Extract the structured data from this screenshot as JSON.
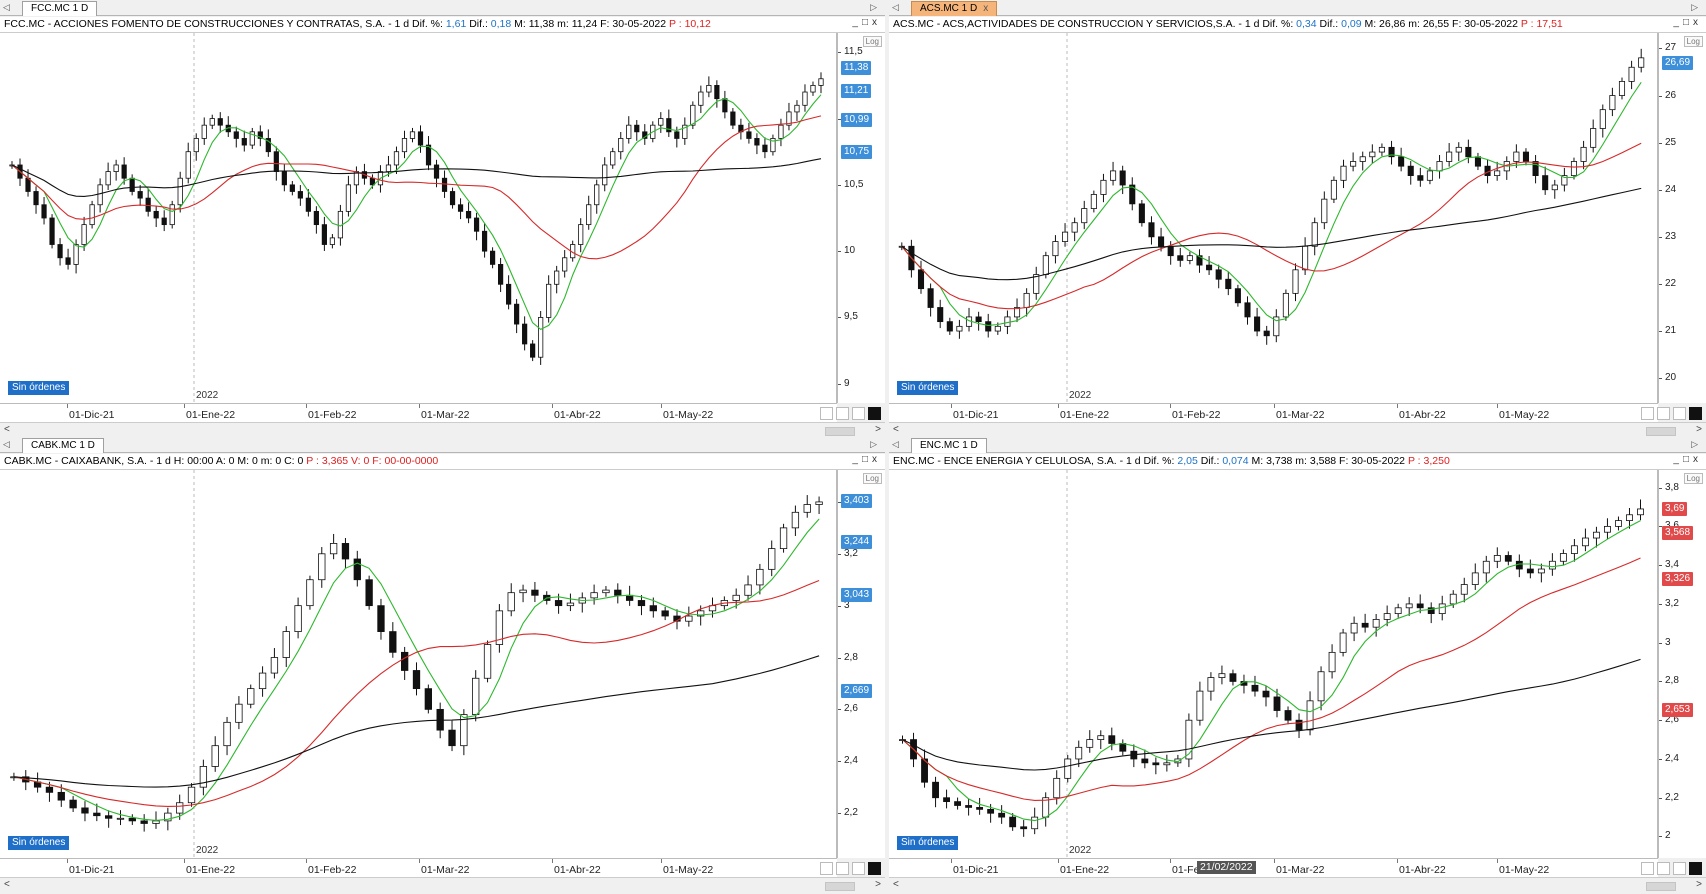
{
  "ui": {
    "sin_ordenes": "Sin órdenes",
    "log_label": "Log",
    "year_label": "2022",
    "close_glyph": "x",
    "win_min": "_",
    "win_max": "□",
    "win_close": "x",
    "scroll_left": "<",
    "scroll_right": ">",
    "tab_left_arrow": "◁",
    "tab_right_arrow": "▷"
  },
  "colors": {
    "ma_short": "#2db82d",
    "ma_mid": "#d62a2a",
    "ma_long": "#111111",
    "candle": "#111111",
    "tag_blue": "#3d8fd9",
    "tag_red": "#e04a4a",
    "active_tab": "#f5b57a"
  },
  "icons": [
    "crosshair-icon",
    "save-icon",
    "pin-icon",
    "color-box-icon"
  ],
  "panels": [
    {
      "id": "fcc",
      "tab": "FCC.MC 1 D",
      "active": false,
      "title": {
        "prefix": "FCC.MC - ACCIONES FOMENTO DE CONSTRUCCIONES Y CONTRATAS, S.A. -  1 d  Dif. %: ",
        "dif_pct": "1,61",
        "mid": "  Dif.: ",
        "dif": "0,18",
        "rest": "  M: 11,38  m: 11,24  F: 30-05-2022  ",
        "p": "P : 10,12"
      },
      "yticks": [
        "11,5",
        "11",
        "10,5",
        "10",
        "9,5",
        "9"
      ],
      "ymin": 8.9,
      "ymax": 11.6,
      "tags": [
        {
          "v": "11,38",
          "c": "blue"
        },
        {
          "v": "11,21",
          "c": "blue"
        },
        {
          "v": "10,99",
          "c": "blue"
        },
        {
          "v": "10,75",
          "c": "blue"
        }
      ],
      "xticks": [
        "01-Dic-21",
        "01-Ene-22",
        "01-Feb-22",
        "01-Mar-22",
        "01-Abr-22",
        "01-May-22"
      ],
      "date_tip": ""
    },
    {
      "id": "acs",
      "tab": "ACS.MC 1 D",
      "active": true,
      "title": {
        "prefix": "ACS.MC - ACS,ACTIVIDADES DE CONSTRUCCION Y SERVICIOS,S.A. -  1 d  Dif. %: ",
        "dif_pct": "0,34",
        "mid": "  Dif.: ",
        "dif": "0,09",
        "rest": "  M: 26,86  m: 26,55  F: 30-05-2022  ",
        "p": "P : 17,51"
      },
      "yticks": [
        "27",
        "26",
        "25",
        "24",
        "23",
        "22",
        "21",
        "20"
      ],
      "ymin": 19.6,
      "ymax": 27.2,
      "tags": [
        {
          "v": "26,69",
          "c": "blue"
        }
      ],
      "xticks": [
        "01-Dic-21",
        "01-Ene-22",
        "01-Feb-22",
        "01-Mar-22",
        "01-Abr-22",
        "01-May-22"
      ],
      "date_tip": ""
    },
    {
      "id": "cabk",
      "tab": "CABK.MC 1 D",
      "active": false,
      "title": {
        "prefix": "CABK.MC - CAIXABANK, S.A. -  1 d  H: 00:00  A: 0  M: 0  m: 0  C: 0  ",
        "dif_pct": "",
        "mid": "",
        "dif": "",
        "rest": "",
        "p": "P : 3,365  V: 0  F: 00-00-0000"
      },
      "yticks": [
        "3,4",
        "3,2",
        "3",
        "2,8",
        "2,6",
        "2,4",
        "2,2"
      ],
      "ymin": 2.05,
      "ymax": 3.5,
      "tags": [
        {
          "v": "3,403",
          "c": "blue"
        },
        {
          "v": "3,244",
          "c": "blue"
        },
        {
          "v": "3,043",
          "c": "blue"
        },
        {
          "v": "2,669",
          "c": "blue"
        }
      ],
      "xticks": [
        "01-Dic-21",
        "01-Ene-22",
        "01-Feb-22",
        "01-Mar-22",
        "01-Abr-22",
        "01-May-22"
      ],
      "date_tip": ""
    },
    {
      "id": "enc",
      "tab": "ENC.MC 1 D",
      "active": false,
      "title": {
        "prefix": "ENC.MC - ENCE ENERGIA Y CELULOSA, S.A. -  1 d  Dif. %: ",
        "dif_pct": "2,05",
        "mid": "  Dif.: ",
        "dif": "0,074",
        "rest": "  M: 3,738  m: 3,588  F: 30-05-2022  ",
        "p": "P : 3,250"
      },
      "yticks": [
        "3,8",
        "3,6",
        "3,4",
        "3,2",
        "3",
        "2,8",
        "2,6",
        "2,4",
        "2,2",
        "2"
      ],
      "ymin": 1.92,
      "ymax": 3.86,
      "tags": [
        {
          "v": "3,69",
          "c": "red"
        },
        {
          "v": "3,568",
          "c": "red"
        },
        {
          "v": "3,326",
          "c": "red"
        },
        {
          "v": "2,653",
          "c": "red"
        }
      ],
      "xticks": [
        "01-Dic-21",
        "01-Ene-22",
        "01-Feb-22",
        "01-Mar-22",
        "01-Abr-22",
        "01-May-22"
      ],
      "date_tip": "21/02/2022"
    }
  ],
  "series": {
    "fcc": [
      10.65,
      10.55,
      10.45,
      10.35,
      10.25,
      10.05,
      9.95,
      9.9,
      10.05,
      10.2,
      10.35,
      10.5,
      10.6,
      10.65,
      10.55,
      10.45,
      10.4,
      10.3,
      10.25,
      10.2,
      10.35,
      10.55,
      10.75,
      10.85,
      10.95,
      11.0,
      10.95,
      10.9,
      10.85,
      10.8,
      10.9,
      10.85,
      10.75,
      10.6,
      10.5,
      10.45,
      10.4,
      10.3,
      10.2,
      10.05,
      10.1,
      10.3,
      10.5,
      10.6,
      10.55,
      10.5,
      10.6,
      10.65,
      10.75,
      10.85,
      10.9,
      10.8,
      10.65,
      10.55,
      10.45,
      10.35,
      10.3,
      10.25,
      10.15,
      10.0,
      9.9,
      9.75,
      9.6,
      9.45,
      9.3,
      9.2,
      9.5,
      9.75,
      9.85,
      9.95,
      10.05,
      10.2,
      10.35,
      10.5,
      10.65,
      10.75,
      10.85,
      10.95,
      10.9,
      10.85,
      10.95,
      11.0,
      10.9,
      10.85,
      10.95,
      11.1,
      11.2,
      11.25,
      11.15,
      11.05,
      10.95,
      10.9,
      10.85,
      10.8,
      10.75,
      10.85,
      10.95,
      11.05,
      11.1,
      11.2,
      11.25,
      11.3
    ],
    "acs": [
      22.8,
      22.3,
      21.9,
      21.5,
      21.2,
      21.0,
      21.1,
      21.3,
      21.2,
      21.0,
      21.1,
      21.3,
      21.5,
      21.8,
      22.2,
      22.6,
      22.9,
      23.1,
      23.3,
      23.6,
      23.9,
      24.2,
      24.4,
      24.1,
      23.7,
      23.3,
      23.0,
      22.8,
      22.6,
      22.5,
      22.6,
      22.4,
      22.3,
      22.1,
      21.9,
      21.6,
      21.3,
      21.0,
      20.9,
      21.3,
      21.8,
      22.3,
      22.8,
      23.3,
      23.8,
      24.2,
      24.5,
      24.6,
      24.7,
      24.8,
      24.9,
      24.7,
      24.5,
      24.3,
      24.2,
      24.4,
      24.6,
      24.8,
      24.9,
      24.7,
      24.5,
      24.3,
      24.4,
      24.6,
      24.8,
      24.6,
      24.3,
      24.0,
      24.1,
      24.3,
      24.6,
      24.9,
      25.3,
      25.7,
      26.0,
      26.3,
      26.6,
      26.8
    ],
    "cabk": [
      2.34,
      2.32,
      2.3,
      2.28,
      2.25,
      2.22,
      2.2,
      2.19,
      2.18,
      2.18,
      2.17,
      2.16,
      2.17,
      2.2,
      2.24,
      2.3,
      2.38,
      2.46,
      2.55,
      2.62,
      2.68,
      2.74,
      2.8,
      2.9,
      3.0,
      3.1,
      3.2,
      3.24,
      3.18,
      3.1,
      3.0,
      2.9,
      2.82,
      2.75,
      2.68,
      2.6,
      2.52,
      2.46,
      2.58,
      2.72,
      2.85,
      2.98,
      3.05,
      3.06,
      3.04,
      3.02,
      3.0,
      3.01,
      3.03,
      3.05,
      3.06,
      3.04,
      3.02,
      3.0,
      2.98,
      2.96,
      2.94,
      2.96,
      2.98,
      3.0,
      3.02,
      3.04,
      3.08,
      3.14,
      3.22,
      3.3,
      3.36,
      3.39,
      3.4
    ],
    "enc": [
      2.5,
      2.4,
      2.28,
      2.2,
      2.18,
      2.16,
      2.15,
      2.14,
      2.12,
      2.1,
      2.05,
      2.04,
      2.1,
      2.2,
      2.3,
      2.4,
      2.46,
      2.5,
      2.52,
      2.48,
      2.44,
      2.4,
      2.38,
      2.37,
      2.38,
      2.4,
      2.6,
      2.75,
      2.82,
      2.84,
      2.8,
      2.78,
      2.75,
      2.72,
      2.65,
      2.6,
      2.55,
      2.7,
      2.85,
      2.95,
      3.05,
      3.1,
      3.08,
      3.12,
      3.15,
      3.18,
      3.2,
      3.18,
      3.15,
      3.2,
      3.25,
      3.3,
      3.36,
      3.42,
      3.45,
      3.42,
      3.38,
      3.36,
      3.38,
      3.42,
      3.46,
      3.5,
      3.54,
      3.57,
      3.6,
      3.63,
      3.66,
      3.69
    ]
  }
}
